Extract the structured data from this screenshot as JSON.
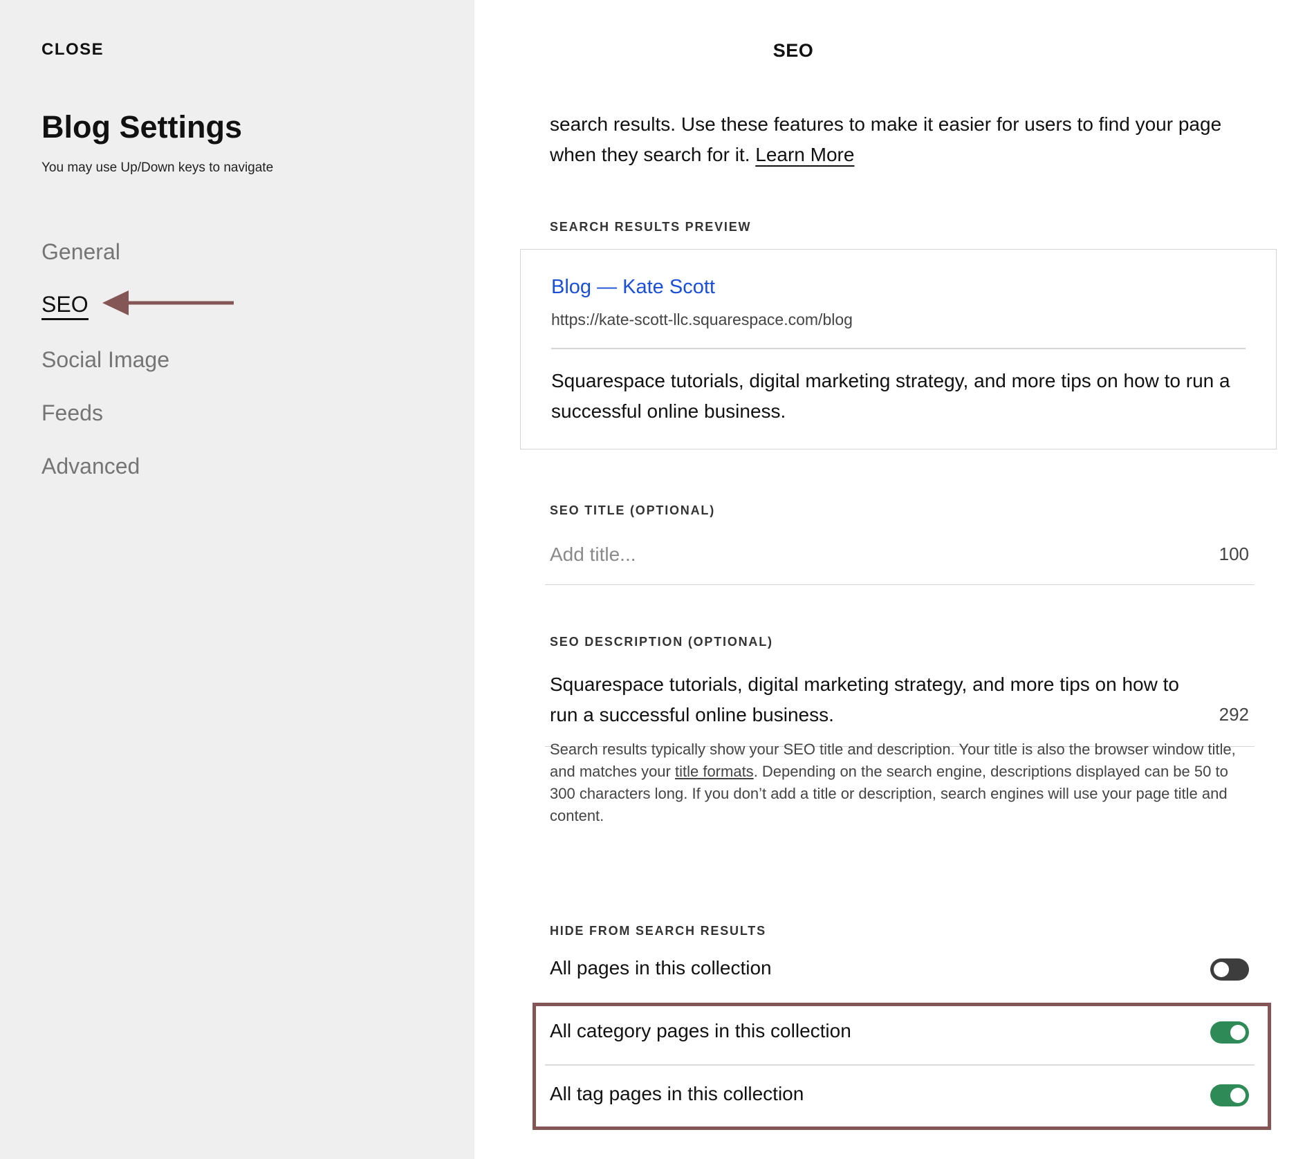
{
  "sidebar": {
    "close_label": "CLOSE",
    "title": "Blog Settings",
    "hint": "You may use Up/Down keys to navigate",
    "nav": [
      {
        "label": "General",
        "active": false
      },
      {
        "label": "SEO",
        "active": true
      },
      {
        "label": "Social Image",
        "active": false
      },
      {
        "label": "Feeds",
        "active": false
      },
      {
        "label": "Advanced",
        "active": false
      }
    ],
    "arrow_color": "#845656"
  },
  "panel": {
    "title": "SEO",
    "intro_text": "search results. Use these features to make it easier for users to find your page when they search for it.",
    "learn_more": "Learn More"
  },
  "preview": {
    "section_label": "SEARCH RESULTS PREVIEW",
    "title": "Blog — Kate Scott",
    "url": "https://kate-scott-llc.squarespace.com/blog",
    "description": "Squarespace tutorials, digital marketing strategy, and more tips on how to run a successful online business.",
    "title_color": "#1a4fd8"
  },
  "seo_title": {
    "label": "SEO TITLE (OPTIONAL)",
    "placeholder": "Add title...",
    "value": "",
    "counter": "100"
  },
  "seo_description": {
    "label": "SEO DESCRIPTION (OPTIONAL)",
    "value": "Squarespace tutorials, digital marketing strategy, and more tips on how to run a successful online business.",
    "counter": "292"
  },
  "help": {
    "before_link": "Search results typically show your SEO title and description. Your title is also the browser window title, and matches your ",
    "link": "title formats",
    "after_link": ". Depending on the search engine, descriptions displayed can be 50 to 300 characters long. If you don’t add a title or description, search engines will use your page title and content."
  },
  "hide": {
    "section_label": "HIDE FROM SEARCH RESULTS",
    "rows": [
      {
        "label": "All pages in this collection",
        "on": false
      },
      {
        "label": "All category pages in this collection",
        "on": true
      },
      {
        "label": "All tag pages in this collection",
        "on": true
      }
    ],
    "toggle_on_color": "#2e8b57",
    "highlight_color": "#845656"
  }
}
